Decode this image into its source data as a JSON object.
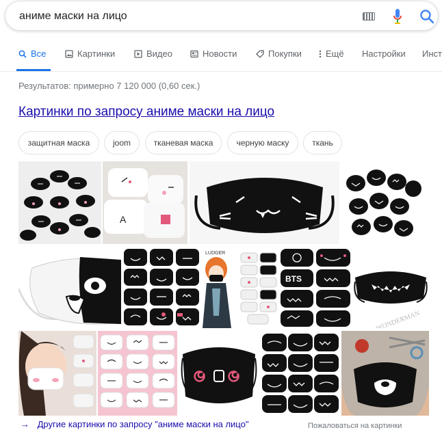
{
  "search": {
    "query": "аниме маски на лицо"
  },
  "tabs": [
    {
      "label": "Все",
      "icon": "search-icon"
    },
    {
      "label": "Картинки",
      "icon": "image-icon"
    },
    {
      "label": "Видео",
      "icon": "video-icon"
    },
    {
      "label": "Новости",
      "icon": "news-icon"
    },
    {
      "label": "Покупки",
      "icon": "tag-icon"
    },
    {
      "label": "Ещё",
      "icon": "more-vertical-icon"
    },
    {
      "label": "Настройки"
    },
    {
      "label": "Инст"
    }
  ],
  "results_stats": "Результатов: примерно 7 120 000 (0,60 сек.)",
  "images_header": "Картинки по запросу аниме маски на лицо",
  "chips": [
    "защитная маска",
    "joom",
    "тканевая маска",
    "черную маску",
    "ткань"
  ],
  "image_texts": {
    "bts": "BTS",
    "ludger": "LUDGER",
    "watermark": "WONDERMAN"
  },
  "more_images_link": "Другие картинки по запросу \"аниме маски на лицо\"",
  "report_link": "Пожаловаться на картинки",
  "colors": {
    "link": "#1a0dab",
    "accent": "#1a73e8",
    "muted": "#70757a"
  }
}
